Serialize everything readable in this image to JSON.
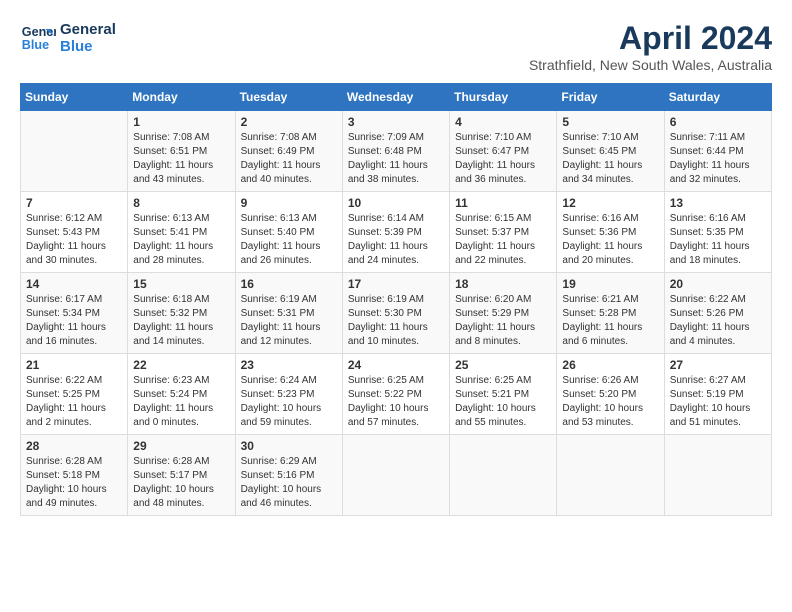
{
  "header": {
    "logo": {
      "line1": "General",
      "line2": "Blue"
    },
    "title": "April 2024",
    "subtitle": "Strathfield, New South Wales, Australia"
  },
  "calendar": {
    "days_of_week": [
      "Sunday",
      "Monday",
      "Tuesday",
      "Wednesday",
      "Thursday",
      "Friday",
      "Saturday"
    ],
    "weeks": [
      [
        {
          "day": "",
          "sunrise": "",
          "sunset": "",
          "daylight": ""
        },
        {
          "day": "1",
          "sunrise": "Sunrise: 7:08 AM",
          "sunset": "Sunset: 6:51 PM",
          "daylight": "Daylight: 11 hours and 43 minutes."
        },
        {
          "day": "2",
          "sunrise": "Sunrise: 7:08 AM",
          "sunset": "Sunset: 6:49 PM",
          "daylight": "Daylight: 11 hours and 40 minutes."
        },
        {
          "day": "3",
          "sunrise": "Sunrise: 7:09 AM",
          "sunset": "Sunset: 6:48 PM",
          "daylight": "Daylight: 11 hours and 38 minutes."
        },
        {
          "day": "4",
          "sunrise": "Sunrise: 7:10 AM",
          "sunset": "Sunset: 6:47 PM",
          "daylight": "Daylight: 11 hours and 36 minutes."
        },
        {
          "day": "5",
          "sunrise": "Sunrise: 7:10 AM",
          "sunset": "Sunset: 6:45 PM",
          "daylight": "Daylight: 11 hours and 34 minutes."
        },
        {
          "day": "6",
          "sunrise": "Sunrise: 7:11 AM",
          "sunset": "Sunset: 6:44 PM",
          "daylight": "Daylight: 11 hours and 32 minutes."
        }
      ],
      [
        {
          "day": "7",
          "sunrise": "Sunrise: 6:12 AM",
          "sunset": "Sunset: 5:43 PM",
          "daylight": "Daylight: 11 hours and 30 minutes."
        },
        {
          "day": "8",
          "sunrise": "Sunrise: 6:13 AM",
          "sunset": "Sunset: 5:41 PM",
          "daylight": "Daylight: 11 hours and 28 minutes."
        },
        {
          "day": "9",
          "sunrise": "Sunrise: 6:13 AM",
          "sunset": "Sunset: 5:40 PM",
          "daylight": "Daylight: 11 hours and 26 minutes."
        },
        {
          "day": "10",
          "sunrise": "Sunrise: 6:14 AM",
          "sunset": "Sunset: 5:39 PM",
          "daylight": "Daylight: 11 hours and 24 minutes."
        },
        {
          "day": "11",
          "sunrise": "Sunrise: 6:15 AM",
          "sunset": "Sunset: 5:37 PM",
          "daylight": "Daylight: 11 hours and 22 minutes."
        },
        {
          "day": "12",
          "sunrise": "Sunrise: 6:16 AM",
          "sunset": "Sunset: 5:36 PM",
          "daylight": "Daylight: 11 hours and 20 minutes."
        },
        {
          "day": "13",
          "sunrise": "Sunrise: 6:16 AM",
          "sunset": "Sunset: 5:35 PM",
          "daylight": "Daylight: 11 hours and 18 minutes."
        }
      ],
      [
        {
          "day": "14",
          "sunrise": "Sunrise: 6:17 AM",
          "sunset": "Sunset: 5:34 PM",
          "daylight": "Daylight: 11 hours and 16 minutes."
        },
        {
          "day": "15",
          "sunrise": "Sunrise: 6:18 AM",
          "sunset": "Sunset: 5:32 PM",
          "daylight": "Daylight: 11 hours and 14 minutes."
        },
        {
          "day": "16",
          "sunrise": "Sunrise: 6:19 AM",
          "sunset": "Sunset: 5:31 PM",
          "daylight": "Daylight: 11 hours and 12 minutes."
        },
        {
          "day": "17",
          "sunrise": "Sunrise: 6:19 AM",
          "sunset": "Sunset: 5:30 PM",
          "daylight": "Daylight: 11 hours and 10 minutes."
        },
        {
          "day": "18",
          "sunrise": "Sunrise: 6:20 AM",
          "sunset": "Sunset: 5:29 PM",
          "daylight": "Daylight: 11 hours and 8 minutes."
        },
        {
          "day": "19",
          "sunrise": "Sunrise: 6:21 AM",
          "sunset": "Sunset: 5:28 PM",
          "daylight": "Daylight: 11 hours and 6 minutes."
        },
        {
          "day": "20",
          "sunrise": "Sunrise: 6:22 AM",
          "sunset": "Sunset: 5:26 PM",
          "daylight": "Daylight: 11 hours and 4 minutes."
        }
      ],
      [
        {
          "day": "21",
          "sunrise": "Sunrise: 6:22 AM",
          "sunset": "Sunset: 5:25 PM",
          "daylight": "Daylight: 11 hours and 2 minutes."
        },
        {
          "day": "22",
          "sunrise": "Sunrise: 6:23 AM",
          "sunset": "Sunset: 5:24 PM",
          "daylight": "Daylight: 11 hours and 0 minutes."
        },
        {
          "day": "23",
          "sunrise": "Sunrise: 6:24 AM",
          "sunset": "Sunset: 5:23 PM",
          "daylight": "Daylight: 10 hours and 59 minutes."
        },
        {
          "day": "24",
          "sunrise": "Sunrise: 6:25 AM",
          "sunset": "Sunset: 5:22 PM",
          "daylight": "Daylight: 10 hours and 57 minutes."
        },
        {
          "day": "25",
          "sunrise": "Sunrise: 6:25 AM",
          "sunset": "Sunset: 5:21 PM",
          "daylight": "Daylight: 10 hours and 55 minutes."
        },
        {
          "day": "26",
          "sunrise": "Sunrise: 6:26 AM",
          "sunset": "Sunset: 5:20 PM",
          "daylight": "Daylight: 10 hours and 53 minutes."
        },
        {
          "day": "27",
          "sunrise": "Sunrise: 6:27 AM",
          "sunset": "Sunset: 5:19 PM",
          "daylight": "Daylight: 10 hours and 51 minutes."
        }
      ],
      [
        {
          "day": "28",
          "sunrise": "Sunrise: 6:28 AM",
          "sunset": "Sunset: 5:18 PM",
          "daylight": "Daylight: 10 hours and 49 minutes."
        },
        {
          "day": "29",
          "sunrise": "Sunrise: 6:28 AM",
          "sunset": "Sunset: 5:17 PM",
          "daylight": "Daylight: 10 hours and 48 minutes."
        },
        {
          "day": "30",
          "sunrise": "Sunrise: 6:29 AM",
          "sunset": "Sunset: 5:16 PM",
          "daylight": "Daylight: 10 hours and 46 minutes."
        },
        {
          "day": "",
          "sunrise": "",
          "sunset": "",
          "daylight": ""
        },
        {
          "day": "",
          "sunrise": "",
          "sunset": "",
          "daylight": ""
        },
        {
          "day": "",
          "sunrise": "",
          "sunset": "",
          "daylight": ""
        },
        {
          "day": "",
          "sunrise": "",
          "sunset": "",
          "daylight": ""
        }
      ]
    ]
  }
}
